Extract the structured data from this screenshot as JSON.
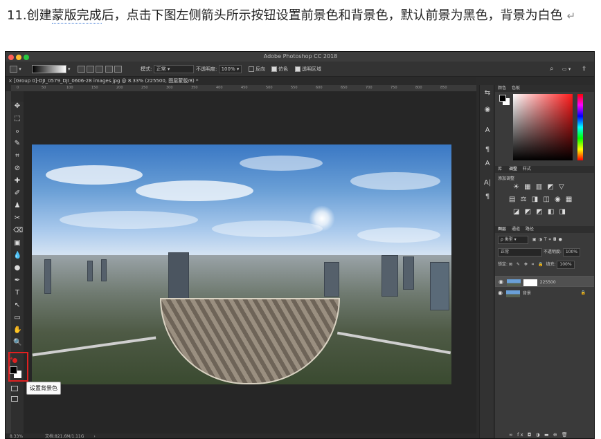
{
  "instruction": {
    "prefix": "11.创建",
    "underlined": "蒙版完成",
    "suffix": "后，点击下图左侧箭头所示按钮设置前景色和背景色，默认前景为黑色，背景为白色",
    "return_mark": "↵"
  },
  "window": {
    "title": "Adobe Photoshop CC 2018",
    "traffic_colors": [
      "#ff5f57",
      "#febc2e",
      "#28c840"
    ]
  },
  "options_bar": {
    "mode_label": "模式:",
    "mode_value": "正常",
    "opacity_label": "不透明度:",
    "opacity_value": "100%",
    "reverse_label": "反向",
    "dither_label": "仿色",
    "transparency_label": "透明区域"
  },
  "document": {
    "tab_title": "[Group 0]-DJI_0579_DJI_0606-28 images.jpg @ 8.33% (225500, 图层蒙版/8) *",
    "ruler_ticks": [
      "0",
      "50",
      "100",
      "150",
      "200",
      "250",
      "300",
      "350",
      "400",
      "450",
      "500",
      "550",
      "600",
      "650",
      "700",
      "750",
      "800",
      "850"
    ]
  },
  "status_bar": {
    "zoom": "8.33%",
    "doc_info": "文档:821.6M/1.11G"
  },
  "tooltip": {
    "text": "设置背景色"
  },
  "tools": [
    "✥",
    "⬚",
    "ℴ",
    "✎",
    "⌗",
    "⊘",
    "✚",
    "✐",
    "♟",
    "✂",
    "⌫",
    "▣",
    "💧",
    "●",
    "✒",
    "T",
    "↖",
    "▭",
    "✋",
    "🔍"
  ],
  "right_icons": [
    "⇆",
    "◉",
    "A",
    "¶",
    "A",
    "A|",
    "¶"
  ],
  "color_panel": {
    "tab_color": "颜色",
    "tab_swatches": "色板"
  },
  "adjust_panel": {
    "tab_library": "库",
    "tab_adjust": "调整",
    "tab_style": "样式",
    "add_label": "添加调整",
    "row1": "☀ ▦ ▥ ◩ ▽",
    "row2": "▤ ⚖ ◨ ◫ ◉ ▦",
    "row3": "◪ ◩ ◩ ◧ ◨"
  },
  "layers_panel": {
    "tab_layers": "图层",
    "tab_channels": "通道",
    "tab_paths": "路径",
    "filter_label": "ρ 类型",
    "blend_value": "正常",
    "opacity_label": "不透明度:",
    "opacity_value": "100%",
    "lock_label": "锁定:",
    "fill_label": "填充:",
    "fill_value": "100%",
    "layers": [
      {
        "name": "225500"
      },
      {
        "name": "背景"
      }
    ],
    "footer": "∞  fx  ◘  ◑  ▬  ⊕  🗑"
  }
}
